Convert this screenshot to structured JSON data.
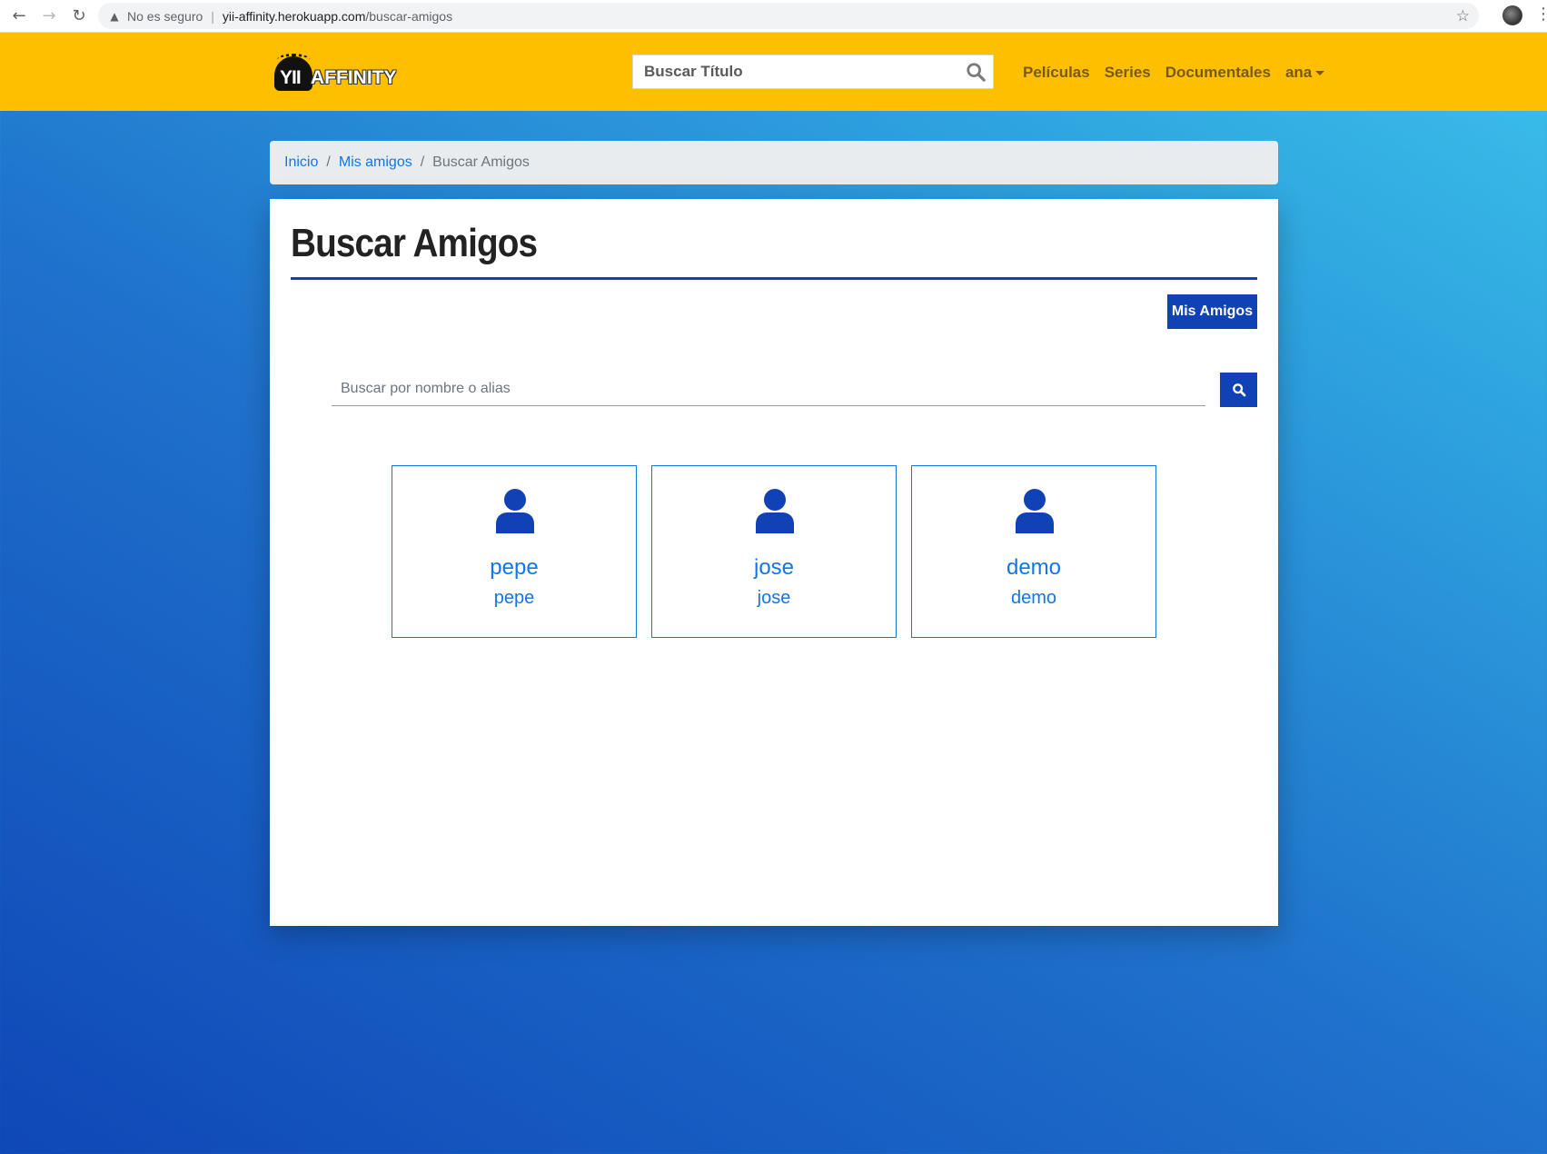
{
  "browser": {
    "back_icon": "arrow-left-icon",
    "forward_icon": "arrow-right-icon",
    "reload_icon": "reload-icon",
    "security_label": "No es seguro",
    "url_host": "yii-affinity.herokuapp.com",
    "url_path": "/buscar-amigos",
    "bookmark_icon": "star-icon",
    "profile_icon": "profile-avatar-icon",
    "menu_icon": "kebab-menu-icon"
  },
  "navbar": {
    "brand_prefix": "YII",
    "brand_suffix": "AFFINITY",
    "search_placeholder": "Buscar Título",
    "links": [
      "Películas",
      "Series",
      "Documentales"
    ],
    "user_menu": "ana",
    "colors": {
      "background": "#fdbf00",
      "link": "#7a5a12"
    }
  },
  "breadcrumb": {
    "items": [
      "Inicio",
      "Mis amigos"
    ],
    "current": "Buscar Amigos",
    "divider": "/"
  },
  "main": {
    "title": "Buscar Amigos",
    "mis_amigos_button": "Mis Amigos",
    "search_placeholder": "Buscar por nombre o alias",
    "accent_color": "#1042b5",
    "link_color": "#1276e6",
    "friends": [
      {
        "name": "pepe",
        "alias": "pepe"
      },
      {
        "name": "jose",
        "alias": "jose"
      },
      {
        "name": "demo",
        "alias": "demo"
      }
    ]
  }
}
